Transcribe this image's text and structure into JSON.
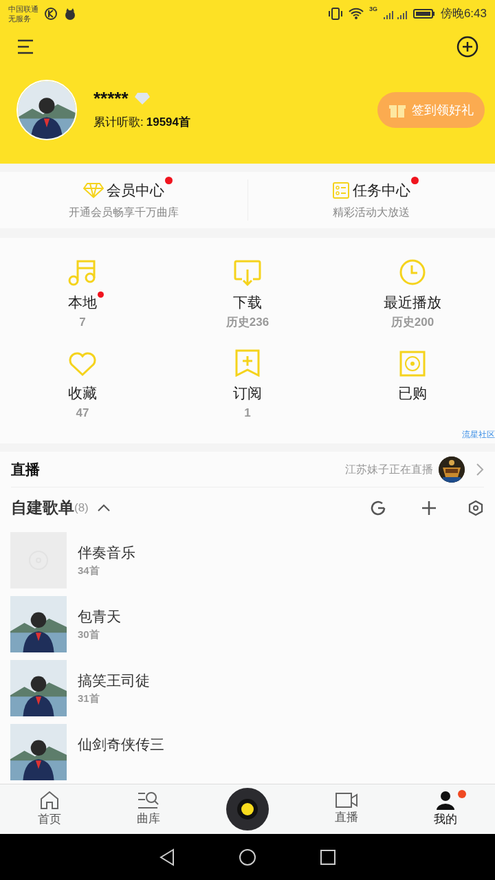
{
  "status_bar": {
    "carrier": "中国联通",
    "service": "无服务",
    "network": "3G",
    "time": "傍晚6:43"
  },
  "profile": {
    "name": "*****",
    "listen_label": "累计听歌:",
    "listen_count": "19594首",
    "checkin_button": "签到领好礼"
  },
  "promos": [
    {
      "kind": "vip",
      "title": "会员中心",
      "subtitle": "开通会员畅享千万曲库",
      "badge": true
    },
    {
      "kind": "task",
      "title": "任务中心",
      "subtitle": "精彩活动大放送",
      "badge": true
    }
  ],
  "shortcuts": [
    {
      "kind": "music",
      "label": "本地",
      "count": "7",
      "badge": true
    },
    {
      "kind": "download",
      "label": "下载",
      "count": "历史236",
      "badge": false
    },
    {
      "kind": "recent",
      "label": "最近播放",
      "count": "历史200",
      "badge": false
    },
    {
      "kind": "favorite",
      "label": "收藏",
      "count": "47",
      "badge": false
    },
    {
      "kind": "subscribe",
      "label": "订阅",
      "count": "1",
      "badge": false
    },
    {
      "kind": "purchased",
      "label": "已购",
      "badge": false
    }
  ],
  "community_link": "流星社区",
  "live": {
    "title": "直播",
    "status": "江苏妹子正在直播"
  },
  "playlists_header": {
    "title": "自建歌单",
    "count": "(8)",
    "expanded": true
  },
  "playlists": [
    {
      "name": "伴奏音乐",
      "songs": "34首",
      "kind": "blank"
    },
    {
      "name": "包青天",
      "songs": "30首",
      "kind": "picture"
    },
    {
      "name": "搞笑王司徒",
      "songs": "31首",
      "kind": "picture"
    },
    {
      "name": "仙剑奇侠传三",
      "kind": "picture"
    }
  ],
  "tab_bar": [
    {
      "kind": "home",
      "label": "首页",
      "selected": false,
      "badge": false
    },
    {
      "kind": "library",
      "label": "曲库",
      "selected": false,
      "badge": false
    },
    {
      "kind": "player"
    },
    {
      "kind": "live",
      "label": "直播",
      "selected": false,
      "badge": false
    },
    {
      "kind": "me",
      "label": "我的",
      "selected": true,
      "badge": true
    }
  ]
}
